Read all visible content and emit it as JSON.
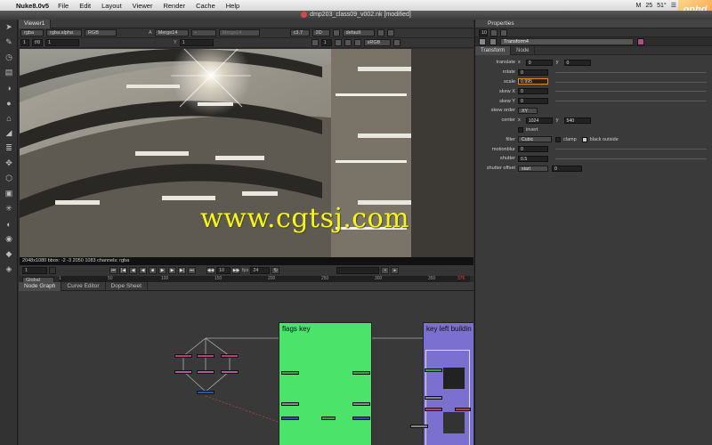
{
  "menubar": {
    "app_name": "Nuke8.0v5",
    "items": [
      "File",
      "Edit",
      "Layout",
      "Viewer",
      "Render",
      "Cache",
      "Help"
    ],
    "status": [
      "M",
      "25",
      "51°",
      "☰"
    ],
    "watermark": "ophd"
  },
  "window": {
    "title": "dmp203_class09_v002.nk [modified]"
  },
  "toolbar": {
    "icons": [
      "pointer-icon",
      "paint-icon",
      "time-icon",
      "channel-icon",
      "color-icon",
      "filter-icon",
      "keyer-icon",
      "merge-icon",
      "transform-icon",
      "3d-icon",
      "views-icon",
      "metadata-icon",
      "particles-icon",
      "deep-icon",
      "toolsets-icon",
      "other-icon",
      "plugins-icon"
    ]
  },
  "viewer": {
    "tab": "Viewer1",
    "row1": {
      "channels": "rgba",
      "layer": "rgba.alpha",
      "display": "RGB",
      "a_label": "A",
      "a_input": "Merge14",
      "dash": "-",
      "b_input": "Merge14",
      "zoom": "c3.7",
      "proxy": "2D",
      "lut": "default"
    },
    "row2": {
      "frame": "1",
      "fstop": "f/8",
      "gain": "1",
      "y_label": "Y",
      "gamma": "1",
      "view": "1",
      "colorspace": "sRGB"
    },
    "info": "2048x1080  bbox: -2 -3 2050 1083 channels: rgba",
    "transport": {
      "frame": "1",
      "step": "10",
      "fps_label": "fps",
      "fps": "24"
    },
    "timeline": {
      "range": "Global",
      "ticks": [
        "1",
        "50",
        "100",
        "150",
        "200",
        "250",
        "300",
        "350",
        "376"
      ]
    }
  },
  "watermark_text": "www.cgtsj.com",
  "nodegraph": {
    "tabs": [
      "Node Graph",
      "Curve Editor",
      "Dope Sheet"
    ],
    "backdrops": [
      {
        "label": "flags key",
        "color": "#4be36a"
      },
      {
        "label": "key left buildin",
        "color": "#7b6fd0"
      }
    ]
  },
  "properties": {
    "title": "Properties",
    "count": "10",
    "node_name": "Transform4",
    "tabs": [
      "Transform",
      "Node"
    ],
    "rows": {
      "translate_label": "translate",
      "translate_x_label": "x",
      "translate_x": "0",
      "translate_y_label": "y",
      "translate_y": "0",
      "rotate_label": "rotate",
      "rotate": "0",
      "scale_label": "scale",
      "scale": "0.995",
      "skew_x_label": "skew X",
      "skew_x": "0",
      "skew_y_label": "skew Y",
      "skew_y": "0",
      "skew_order_label": "skew order",
      "skew_order": "XY",
      "center_label": "center",
      "center_x_label": "x",
      "center_x": "1024",
      "center_y_label": "y",
      "center_y": "540",
      "invert_label": "invert",
      "filter_label": "filter",
      "filter": "Cubic",
      "clamp_label": "clamp",
      "black_outside_label": "black outside",
      "motionblur_label": "motionblur",
      "motionblur": "0",
      "shutter_label": "shutter",
      "shutter": "0.5",
      "shutter_offset_label": "shutter offset",
      "shutter_offset": "start",
      "shutter_offset_value": "0"
    }
  }
}
